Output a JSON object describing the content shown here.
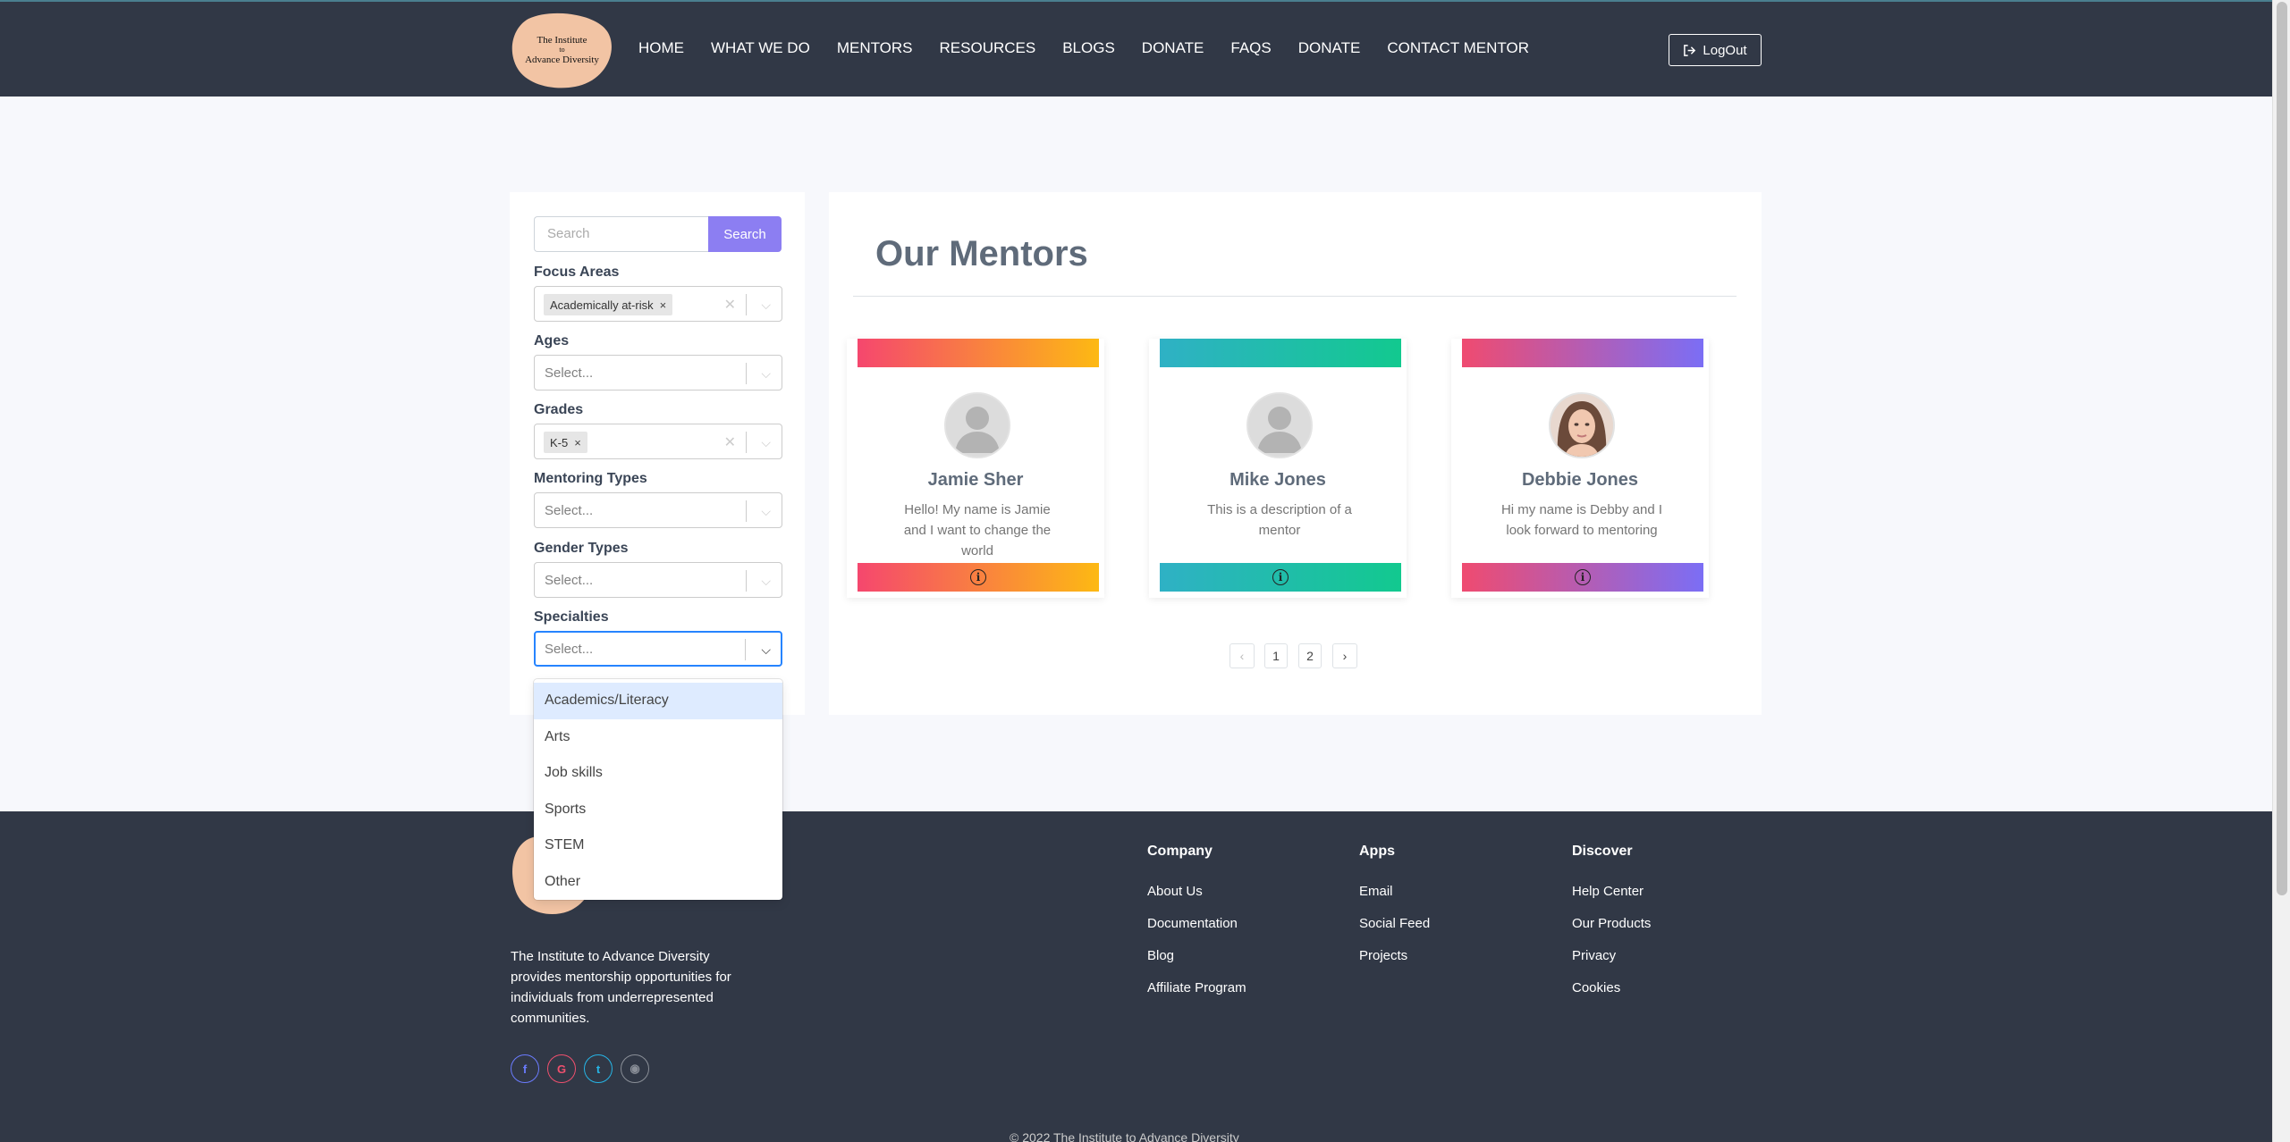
{
  "header": {
    "logo_line1": "The Institute",
    "logo_line2": "to",
    "logo_line3": "Advance Diversity",
    "nav": [
      "HOME",
      "WHAT WE DO",
      "MENTORS",
      "RESOURCES",
      "BLOGS",
      "DONATE",
      "FAQS",
      "DONATE",
      "CONTACT MENTOR"
    ],
    "logout_label": "LogOut"
  },
  "filters": {
    "search_placeholder": "Search",
    "search_button": "Search",
    "focus_areas": {
      "label": "Focus Areas",
      "selected": "Academically at-risk"
    },
    "ages": {
      "label": "Ages",
      "placeholder": "Select..."
    },
    "grades": {
      "label": "Grades",
      "selected": "K-5"
    },
    "mentoring_types": {
      "label": "Mentoring Types",
      "placeholder": "Select..."
    },
    "gender_types": {
      "label": "Gender Types",
      "placeholder": "Select..."
    },
    "specialties": {
      "label": "Specialties",
      "placeholder": "Select...",
      "options": [
        "Academics/Literacy",
        "Arts",
        "Job skills",
        "Sports",
        "STEM",
        "Other"
      ]
    }
  },
  "mentors": {
    "title": "Our Mentors",
    "cards": [
      {
        "name": "Jamie Sher",
        "description": "Hello! My name is Jamie and I want to change the world",
        "gradient": [
          "#f5476e",
          "#fdb913"
        ]
      },
      {
        "name": "Mike Jones",
        "description": "This is a description of a mentor",
        "gradient": [
          "#2fb1c5",
          "#12c98f"
        ]
      },
      {
        "name": "Debbie Jones",
        "description": "Hi my name is Debby and I look forward to mentoring",
        "gradient": [
          "#ef4b70",
          "#7b6ef5"
        ]
      }
    ],
    "pagination": {
      "prev": "‹",
      "pages": [
        "1",
        "2"
      ],
      "next": "›"
    }
  },
  "footer": {
    "about": "The Institute to Advance Diversity provides mentorship opportunities for individuals from underrepresented communities.",
    "columns": [
      {
        "heading": "Company",
        "links": [
          "About Us",
          "Documentation",
          "Blog",
          "Affiliate Program"
        ]
      },
      {
        "heading": "Apps",
        "links": [
          "Email",
          "Social Feed",
          "Projects"
        ]
      },
      {
        "heading": "Discover",
        "links": [
          "Help Center",
          "Our Products",
          "Privacy",
          "Cookies"
        ]
      }
    ],
    "social": [
      {
        "name": "facebook-icon",
        "glyph": "f",
        "color": "#6b7cff"
      },
      {
        "name": "google-icon",
        "glyph": "G",
        "color": "#f0506e"
      },
      {
        "name": "twitter-icon",
        "glyph": "t",
        "color": "#26b5e6"
      },
      {
        "name": "github-icon",
        "glyph": "◉",
        "color": "#8a8f98"
      }
    ],
    "copyright": "© 2022 The Institute to Advance Diversity"
  },
  "colors": {
    "navbar": "#313846",
    "accent": "#8c7ef2",
    "focus": "#2684ff"
  }
}
